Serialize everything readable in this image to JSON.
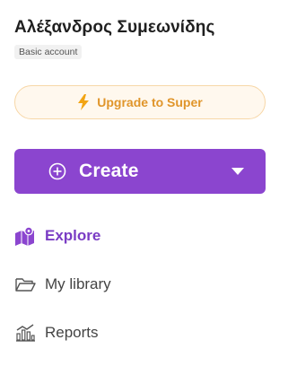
{
  "account": {
    "user_name": "Αλέξανδρος Συμεωνίδης",
    "account_type": "Basic account"
  },
  "upgrade": {
    "label": "Upgrade to Super",
    "icon": "lightning-bolt-icon",
    "color": "#e0952a"
  },
  "create": {
    "label": "Create",
    "icon": "plus-circle-icon",
    "dropdown_icon": "caret-down-icon",
    "color": "#8b45cf"
  },
  "nav": {
    "items": [
      {
        "label": "Explore",
        "icon": "map-icon",
        "active": true
      },
      {
        "label": "My library",
        "icon": "folder-icon",
        "active": false
      },
      {
        "label": "Reports",
        "icon": "reports-icon",
        "active": false
      }
    ]
  }
}
